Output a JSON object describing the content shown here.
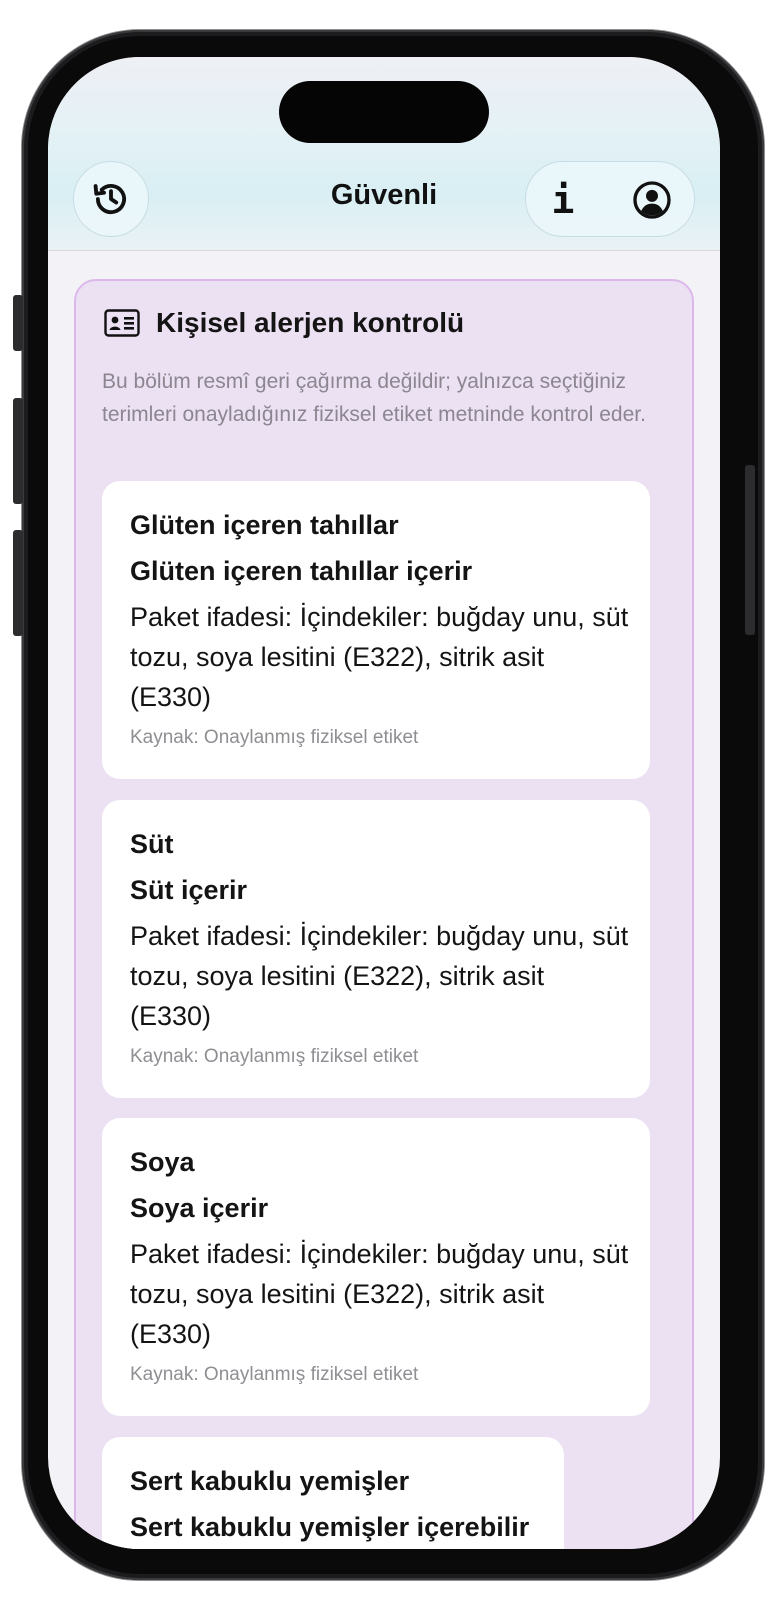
{
  "header": {
    "title": "Güvenli",
    "history_icon": "history-icon",
    "info_icon": "info-icon",
    "profile_icon": "profile-icon"
  },
  "panel": {
    "icon": "id-card-icon",
    "title": "Kişisel alerjen kontrolü",
    "description": "Bu bölüm resmî geri çağırma değildir; yalnızca seçtiğiniz terimleri onayladığınız fiziksel etiket metninde kontrol eder.",
    "cards": [
      {
        "allergen": "Glüten içeren tahıllar",
        "status": "Glüten içeren tahıllar içerir",
        "package_text": "Paket ifadesi: İçindekiler: buğday unu, süt tozu, soya lesitini (E322), sitrik asit (E330)",
        "source": "Kaynak: Onaylanmış fiziksel etiket"
      },
      {
        "allergen": "Süt",
        "status": "Süt içerir",
        "package_text": "Paket ifadesi: İçindekiler: buğday unu, süt tozu, soya lesitini (E322), sitrik asit (E330)",
        "source": "Kaynak: Onaylanmış fiziksel etiket"
      },
      {
        "allergen": "Soya",
        "status": "Soya içerir",
        "package_text": "Paket ifadesi: İçindekiler: buğday unu, süt tozu, soya lesitini (E322), sitrik asit (E330)",
        "source": "Kaynak: Onaylanmış fiziksel etiket"
      },
      {
        "allergen": "Sert kabuklu yemişler",
        "status": "Sert kabuklu yemişler içerebilir",
        "package_text": "",
        "source": ""
      }
    ]
  }
}
